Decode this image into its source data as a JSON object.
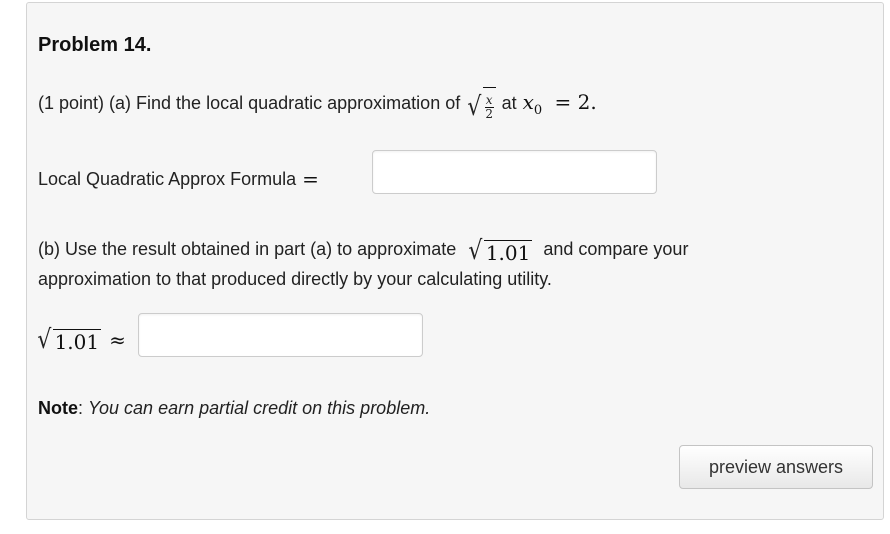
{
  "problem": {
    "title": "Problem 14.",
    "part_a": {
      "prefix": "(1 point) (a) Find the local quadratic approximation of",
      "fraction_numerator": "x",
      "fraction_denominator": "2",
      "at_text": "at",
      "point_expr": "x",
      "point_sub": "0",
      "point_value": "= 2."
    },
    "formula_label": "Local Quadratic Approx Formula",
    "formula_equals": "=",
    "formula_value": "",
    "part_b": {
      "text_1": "(b) Use the result obtained in part (a) to approximate",
      "radicand": "1.01",
      "text_2": "and compare your",
      "text_3": "approximation to that produced directly by your calculating utility."
    },
    "approx": {
      "radicand": "1.01",
      "symbol": "≈",
      "value": ""
    },
    "note": {
      "label": "Note",
      "text": "You can earn partial credit on this problem."
    }
  },
  "buttons": {
    "preview": "preview answers"
  }
}
